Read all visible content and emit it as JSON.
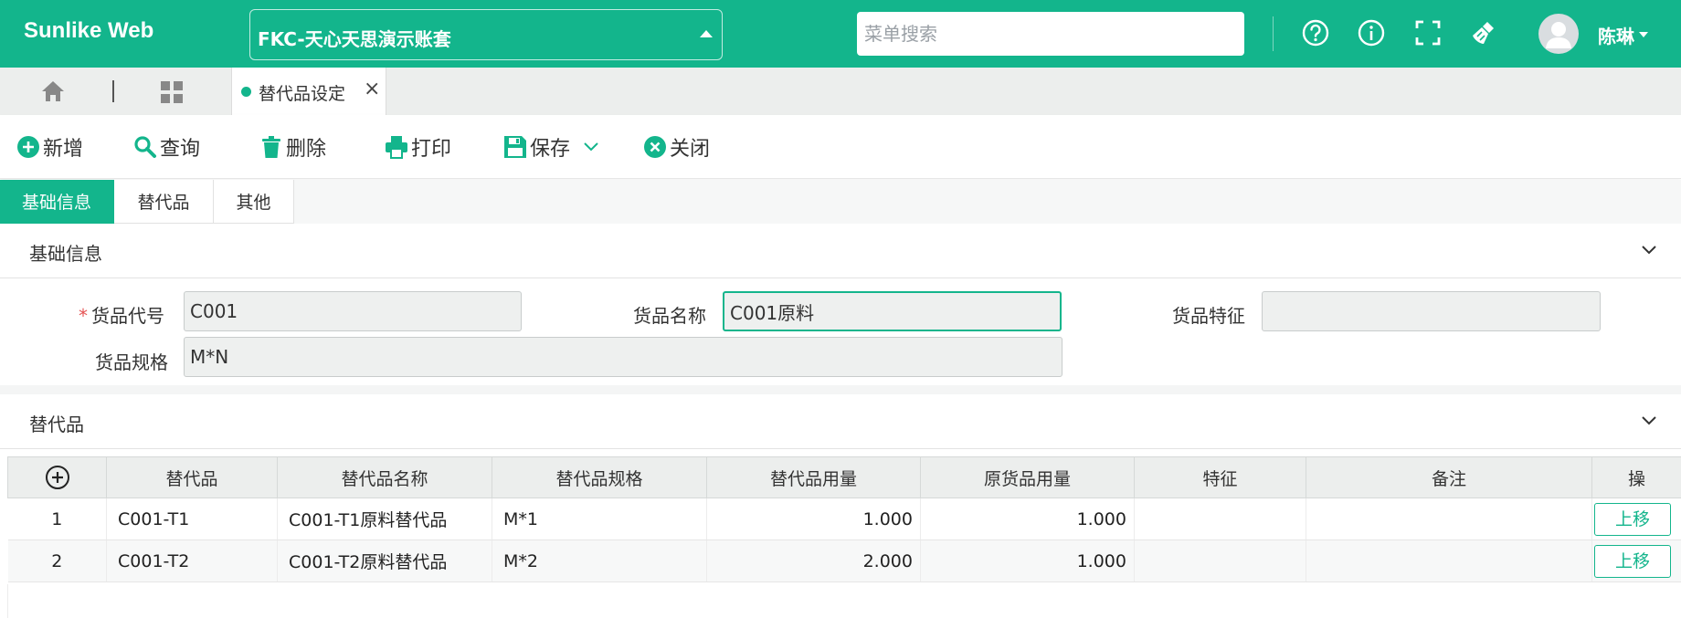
{
  "header": {
    "brand": "Sunlike Web",
    "account": "FKC-天心天思演示账套",
    "search_placeholder": "菜单搜索",
    "username": "陈琳"
  },
  "tabbar": {
    "open_tab": "替代品设定",
    "close": "×"
  },
  "toolbar": {
    "add": "新增",
    "query": "查询",
    "delete": "删除",
    "print": "打印",
    "save": "保存",
    "close": "关闭"
  },
  "form_tabs": [
    "基础信息",
    "替代品",
    "其他"
  ],
  "basic": {
    "title": "基础信息",
    "required_mark": "*",
    "code_label": "货品代号",
    "code_value": "C001",
    "name_label": "货品名称",
    "name_value": "C001原料",
    "feature_label": "货品特征",
    "feature_value": "",
    "spec_label": "货品规格",
    "spec_value": "M*N"
  },
  "substitutes": {
    "title": "替代品",
    "columns": [
      "替代品",
      "替代品名称",
      "替代品规格",
      "替代品用量",
      "原货品用量",
      "特征",
      "备注",
      "操"
    ],
    "rows": [
      {
        "no": "1",
        "code": "C001-T1",
        "name": "C001-T1原料替代品",
        "spec": "M*1",
        "qty": "1.000",
        "orig_qty": "1.000",
        "feature": "",
        "remark": "",
        "action": "上移"
      },
      {
        "no": "2",
        "code": "C001-T2",
        "name": "C001-T2原料替代品",
        "spec": "M*2",
        "qty": "2.000",
        "orig_qty": "1.000",
        "feature": "",
        "remark": "",
        "action": "上移"
      }
    ]
  },
  "colors": {
    "primary": "#13b58c",
    "required": "#e55353"
  }
}
